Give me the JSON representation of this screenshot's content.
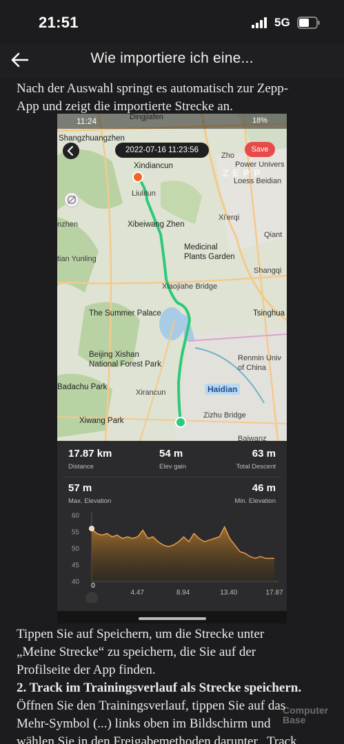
{
  "status_bar": {
    "time": "21:51",
    "network": "5G"
  },
  "header": {
    "title": "Wie importiere ich eine..."
  },
  "article": {
    "para1_line1": "Nach der Auswahl springt es automatisch zur Zepp-",
    "para1_line2": "App und zeigt die importierte Strecke an.",
    "para2_line1": "Tippen Sie auf Speichern, um die Strecke unter",
    "para2_line2": "„Meine Strecke“ zu speichern, die Sie auf der",
    "para2_line3": "Profilseite der App finden.",
    "heading": "2. Track im Trainingsverlauf als Strecke speichern.",
    "para3_line1": "Öffnen Sie den Trainingsverlauf, tippen Sie auf das",
    "para3_line2": "Mehr-Symbol (...) links oben im Bildschirm und",
    "para3_line3": "wählen Sie in den Freigabemethoden darunter „Track"
  },
  "screenshot": {
    "status_time": "11:24",
    "status_battery": "18%",
    "date": "2022-07-16 11:23:56",
    "save_label": "Save",
    "brand": "ZEPP",
    "map_labels": {
      "dingjiafen": "Dingjiafen",
      "shangzhuangzhen": "Shangzhuangzhen",
      "xindiancun": "Xindiancun",
      "liulitun": "Liulitun",
      "xibeiwang": "Xibeiwang Zhen",
      "zhen": "nzhen",
      "xierqi": "Xi'erqi",
      "medicinal1": "Medicinal",
      "medicinal2": "Plants Garden",
      "qiant": "Qiant",
      "tianyunling": "tian Yunling",
      "shangqin": "Shangqi",
      "xiaojiahe": "Xiaojiahe Bridge",
      "summerpalace": "The Summer Palace",
      "tsinghua": "Tsinghua",
      "xishan1": "Beijing Xishan",
      "xishan2": "National Forest Park",
      "renmin1": "Renmin Univ",
      "renmin2": "of China",
      "badachu": "Badachu Park",
      "haidian": "Haidian",
      "xirancun": "Xirancun",
      "xiwang": "Xiwang Park",
      "zizhu": "Zizhu Bridge",
      "power": "Power Univers",
      "loess": "Loess Beidian",
      "zhong": "Zho",
      "baiwan": "Baiwanz"
    },
    "stats": {
      "distance_value": "17.87 km",
      "distance_label": "Distance",
      "elev_gain_value": "54 m",
      "elev_gain_label": "Elev gain",
      "descent_value": "63 m",
      "descent_label": "Total Descent",
      "max_elev_value": "57 m",
      "max_elev_label": "Max. Elevation",
      "min_elev_value": "46 m",
      "min_elev_label": "Min. Elevation"
    },
    "colors": {
      "route": "#2dc97a",
      "start": "#f26522",
      "end": "#2dc97a",
      "chart_line": "#f2a14a"
    }
  },
  "watermark": {
    "line1": "Computer",
    "line2": "Base"
  },
  "chart_data": {
    "type": "area",
    "x_ticks": [
      "0",
      "4.47",
      "8.94",
      "13.40",
      "17.87"
    ],
    "y_ticks": [
      "60",
      "55",
      "50",
      "45",
      "40"
    ],
    "ylim": [
      40,
      60
    ],
    "xlim": [
      0,
      17.87
    ],
    "x": [
      0,
      0.5,
      1,
      1.5,
      2,
      2.5,
      3,
      3.5,
      4,
      4.5,
      5,
      5.5,
      6,
      6.5,
      7,
      7.5,
      8,
      8.5,
      9,
      9.5,
      10,
      10.5,
      11,
      11.5,
      12,
      12.5,
      13,
      13.5,
      14,
      14.5,
      15,
      15.5,
      16,
      16.5,
      17,
      17.87
    ],
    "y": [
      56,
      54.5,
      54,
      54.5,
      53.5,
      54,
      53,
      53.5,
      53,
      53.5,
      55.5,
      53,
      53.5,
      52,
      51,
      50.5,
      51,
      52,
      53.5,
      52,
      54.5,
      53,
      52,
      52.5,
      53,
      53.5,
      56.5,
      53,
      51,
      49,
      48.5,
      47.5,
      47,
      47.5,
      47,
      47
    ]
  }
}
